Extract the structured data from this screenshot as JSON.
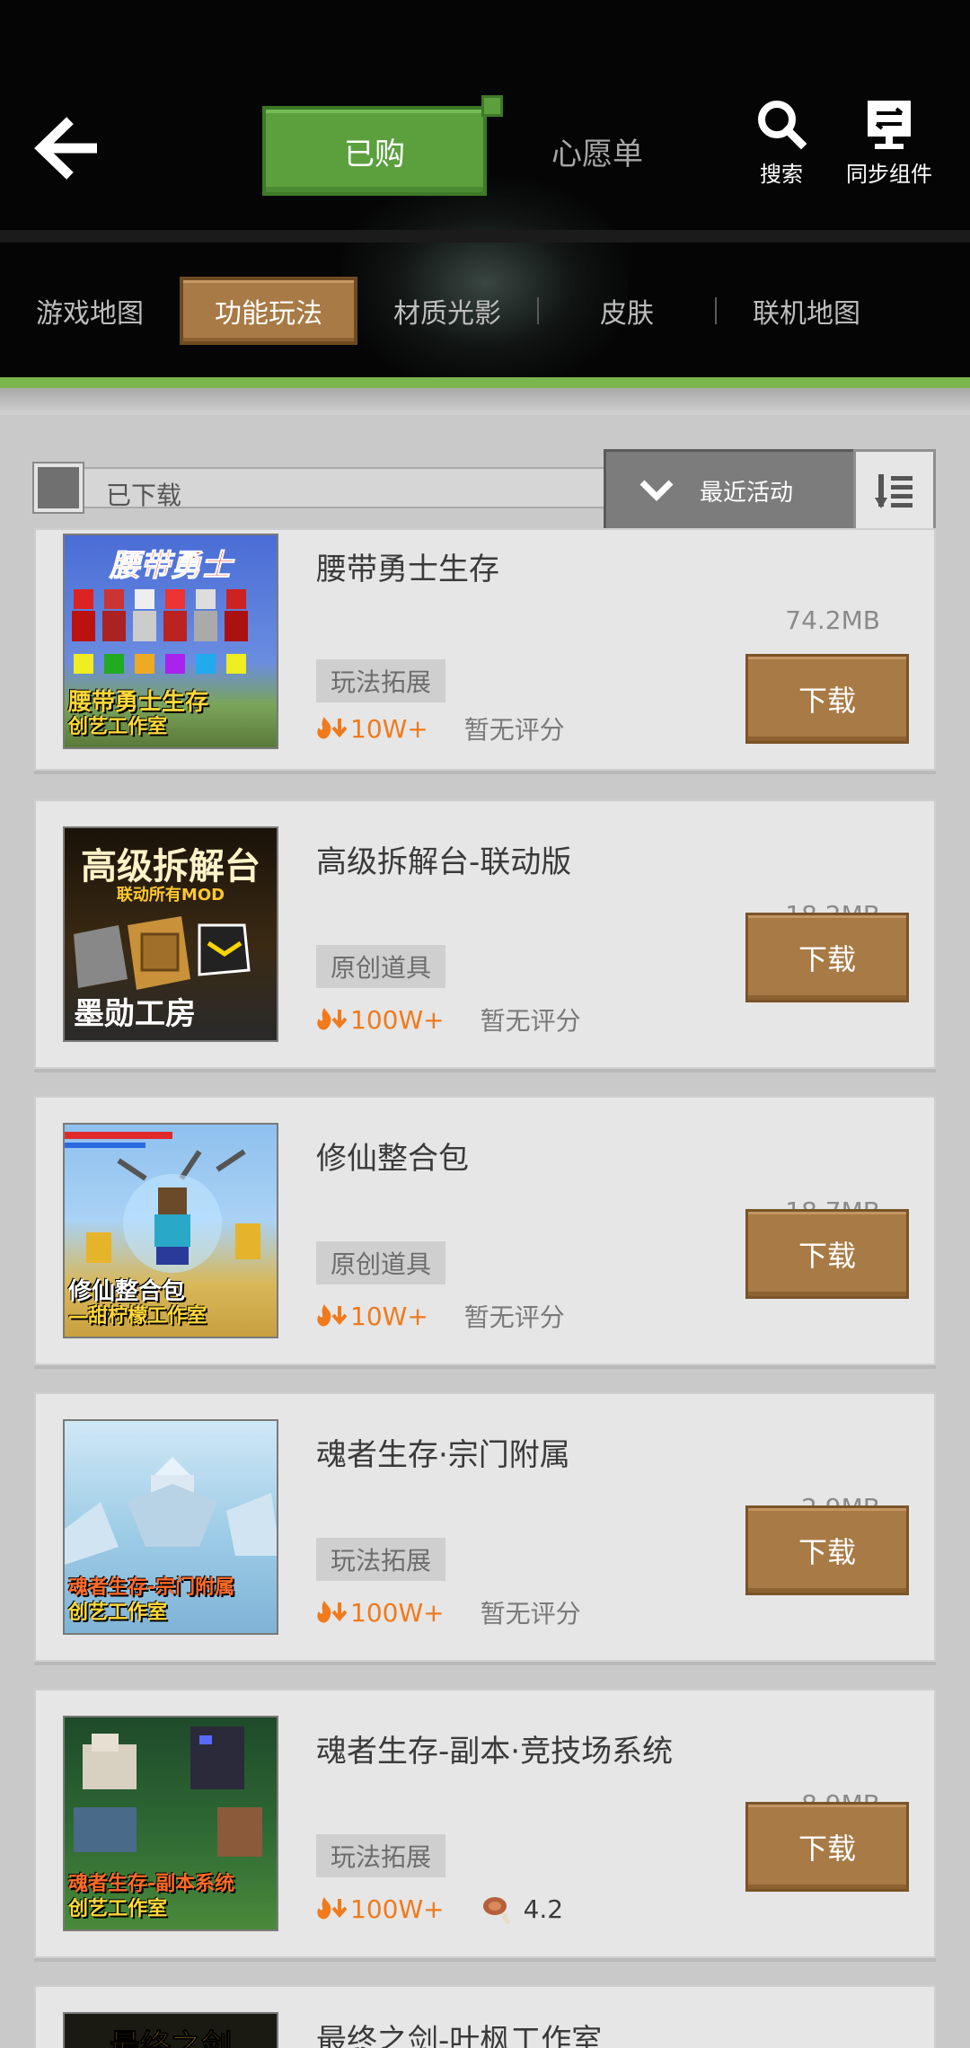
{
  "header": {
    "tabs": [
      {
        "label": "已购",
        "active": true
      },
      {
        "label": "心愿单",
        "active": false
      }
    ],
    "actions": [
      {
        "label": "搜索",
        "icon": "search-icon"
      },
      {
        "label": "同步组件",
        "icon": "sync-component-icon"
      }
    ],
    "categories": [
      {
        "label": "游戏地图",
        "active": false
      },
      {
        "label": "功能玩法",
        "active": true
      },
      {
        "label": "材质光影",
        "active": false
      },
      {
        "label": "皮肤",
        "active": false
      },
      {
        "label": "联机地图",
        "active": false
      }
    ]
  },
  "filter": {
    "downloaded_label": "已下载",
    "sort_label": "最近活动"
  },
  "items": [
    {
      "title": "腰带勇士生存",
      "size": "74.2MB",
      "tag": "玩法拓展",
      "downloads": "10W+",
      "rating": "暂无评分",
      "button": "下载",
      "thumb_title": "腰带勇士",
      "thumb_caption_1": "腰带勇士生存",
      "thumb_caption_2": "创艺工作室"
    },
    {
      "title": "高级拆解台-联动版",
      "size": "18.2MB",
      "tag": "原创道具",
      "downloads": "100W+",
      "rating": "暂无评分",
      "button": "下载",
      "thumb_title": "高级拆解台",
      "thumb_caption_1": "联动所有MOD",
      "thumb_caption_2": "墨勋工房"
    },
    {
      "title": "修仙整合包",
      "size": "18.7MB",
      "tag": "原创道具",
      "downloads": "10W+",
      "rating": "暂无评分",
      "button": "下载",
      "thumb_title": "",
      "thumb_caption_1": "修仙整合包",
      "thumb_caption_2": "—甜柠檬工作室"
    },
    {
      "title": "魂者生存·宗门附属",
      "size": "2.9MB",
      "tag": "玩法拓展",
      "downloads": "100W+",
      "rating": "暂无评分",
      "button": "下载",
      "thumb_title": "",
      "thumb_caption_1": "魂者生存-宗门附属",
      "thumb_caption_2": "创艺工作室"
    },
    {
      "title": "魂者生存-副本·竞技场系统",
      "size": "8.9MB",
      "tag": "玩法拓展",
      "downloads": "100W+",
      "rating": "4.2",
      "button": "下载",
      "thumb_title": "",
      "thumb_caption_1": "魂者生存-副本系统",
      "thumb_caption_2": "创艺工作室"
    },
    {
      "title": "最终之剑-叶枫工作室",
      "thumb_title": "最终之剑"
    }
  ],
  "colors": {
    "accent_green": "#5ca03e",
    "accent_brown": "#a87a45",
    "download_count": "#f07a1c"
  }
}
